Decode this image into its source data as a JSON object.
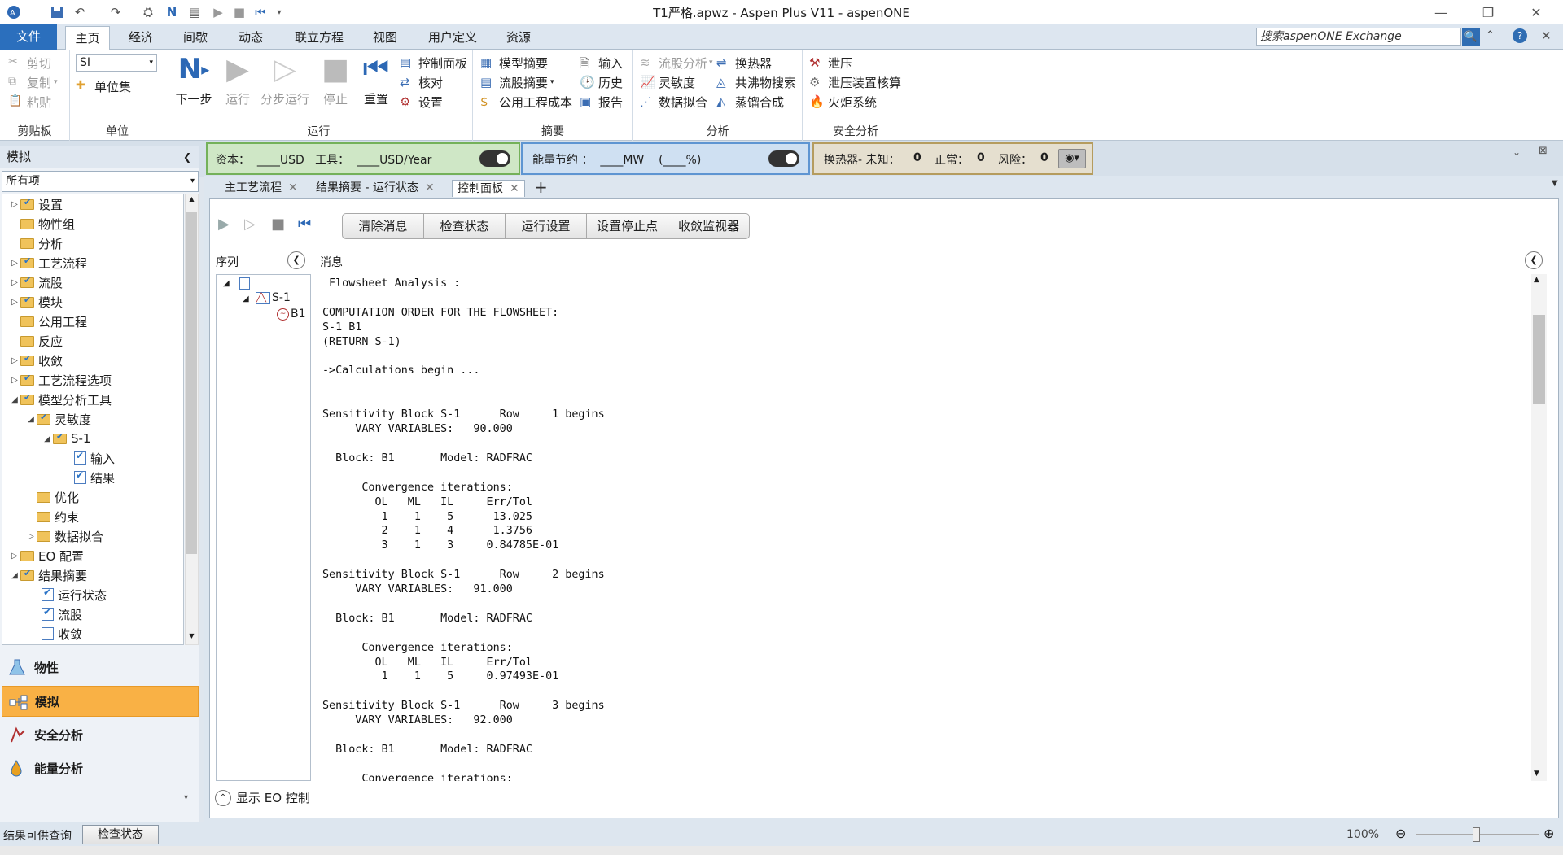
{
  "titlebar": {
    "title": "T1严格.apwz - Aspen Plus V11 - aspenONE"
  },
  "menu": {
    "tabs": [
      "文件",
      "主页",
      "经济",
      "间歇",
      "动态",
      "联立方程",
      "视图",
      "用户定义",
      "资源"
    ],
    "search_placeholder": "搜索aspenONE Exchange"
  },
  "ribbon": {
    "clipboard": {
      "cut": "剪切",
      "copy": "复制",
      "paste": "粘贴",
      "label": "剪贴板"
    },
    "units": {
      "unit_set_value": "SI",
      "unit_sets": "单位集",
      "label": "单位"
    },
    "run": {
      "next": "下一步",
      "run": "运行",
      "step": "分步运行",
      "stop": "停止",
      "reset": "重置",
      "control_panel": "控制面板",
      "reconcile": "核对",
      "settings": "设置",
      "label": "运行"
    },
    "summary": {
      "model_summary": "模型摘要",
      "stream_summary": "流股摘要",
      "utility_costs": "公用工程成本",
      "input": "输入",
      "history": "历史",
      "report": "报告",
      "label": "摘要"
    },
    "analysis": {
      "stream_analysis": "流股分析",
      "sensitivity": "灵敏度",
      "data_fit": "数据拟合",
      "heat_exchanger": "换热器",
      "azeotrope_search": "共沸物搜索",
      "distillation_synthesis": "蒸馏合成",
      "label": "分析"
    },
    "safety": {
      "pressure_relief": "泄压",
      "relief_sizing": "泄压装置核算",
      "flare_system": "火炬系统",
      "label": "安全分析"
    }
  },
  "strip": {
    "capital": "资本：  ____USD   工具：  ____USD/Year",
    "energy": "能量节约 ：  ____MW    (____%)",
    "hex_label": "换热器- 未知：",
    "hex_unknown": "0",
    "normal_label": "正常：",
    "normal": "0",
    "risk_label": "风险：",
    "risk": "0"
  },
  "nav": {
    "title": "模拟",
    "filter": "所有项",
    "tree": [
      "设置",
      "物性组",
      "分析",
      "工艺流程",
      "流股",
      "模块",
      "公用工程",
      "反应",
      "收敛",
      "工艺流程选项",
      "模型分析工具",
      "灵敏度",
      "S-1",
      "输入",
      "结果",
      "优化",
      "约束",
      "数据拟合",
      "EO 配置",
      "结果摘要",
      "运行状态",
      "流股",
      "收敛"
    ],
    "buttons": [
      "物性",
      "模拟",
      "安全分析",
      "能量分析"
    ]
  },
  "doc_tabs": [
    "主工艺流程",
    "结果摘要 - 运行状态",
    "控制面板"
  ],
  "panel": {
    "buttons": [
      "清除消息",
      "检查状态",
      "运行设置",
      "设置停止点",
      "收敛监视器"
    ],
    "seq_header": "序列",
    "msg_header": "消息",
    "seq_tree": [
      "S-1",
      "B1"
    ],
    "messages": [
      " Flowsheet Analysis :",
      "",
      "COMPUTATION ORDER FOR THE FLOWSHEET:",
      "S-1 B1",
      "(RETURN S-1)",
      "",
      "->Calculations begin ...",
      "",
      "",
      "Sensitivity Block S-1      Row     1 begins",
      "     VARY VARIABLES:   90.000",
      "",
      "  Block: B1       Model: RADFRAC",
      "",
      "      Convergence iterations:",
      "        OL   ML   IL     Err/Tol",
      "         1    1    5      13.025",
      "         2    1    4      1.3756",
      "         3    1    3     0.84785E-01",
      "",
      "Sensitivity Block S-1      Row     2 begins",
      "     VARY VARIABLES:   91.000",
      "",
      "  Block: B1       Model: RADFRAC",
      "",
      "      Convergence iterations:",
      "        OL   ML   IL     Err/Tol",
      "         1    1    5     0.97493E-01",
      "",
      "Sensitivity Block S-1      Row     3 begins",
      "     VARY VARIABLES:   92.000",
      "",
      "  Block: B1       Model: RADFRAC",
      "",
      "      Convergence iterations:"
    ],
    "eo_control": "显示 EO 控制"
  },
  "status": {
    "message": "结果可供查询",
    "check_status": "检查状态",
    "zoom": "100%"
  }
}
